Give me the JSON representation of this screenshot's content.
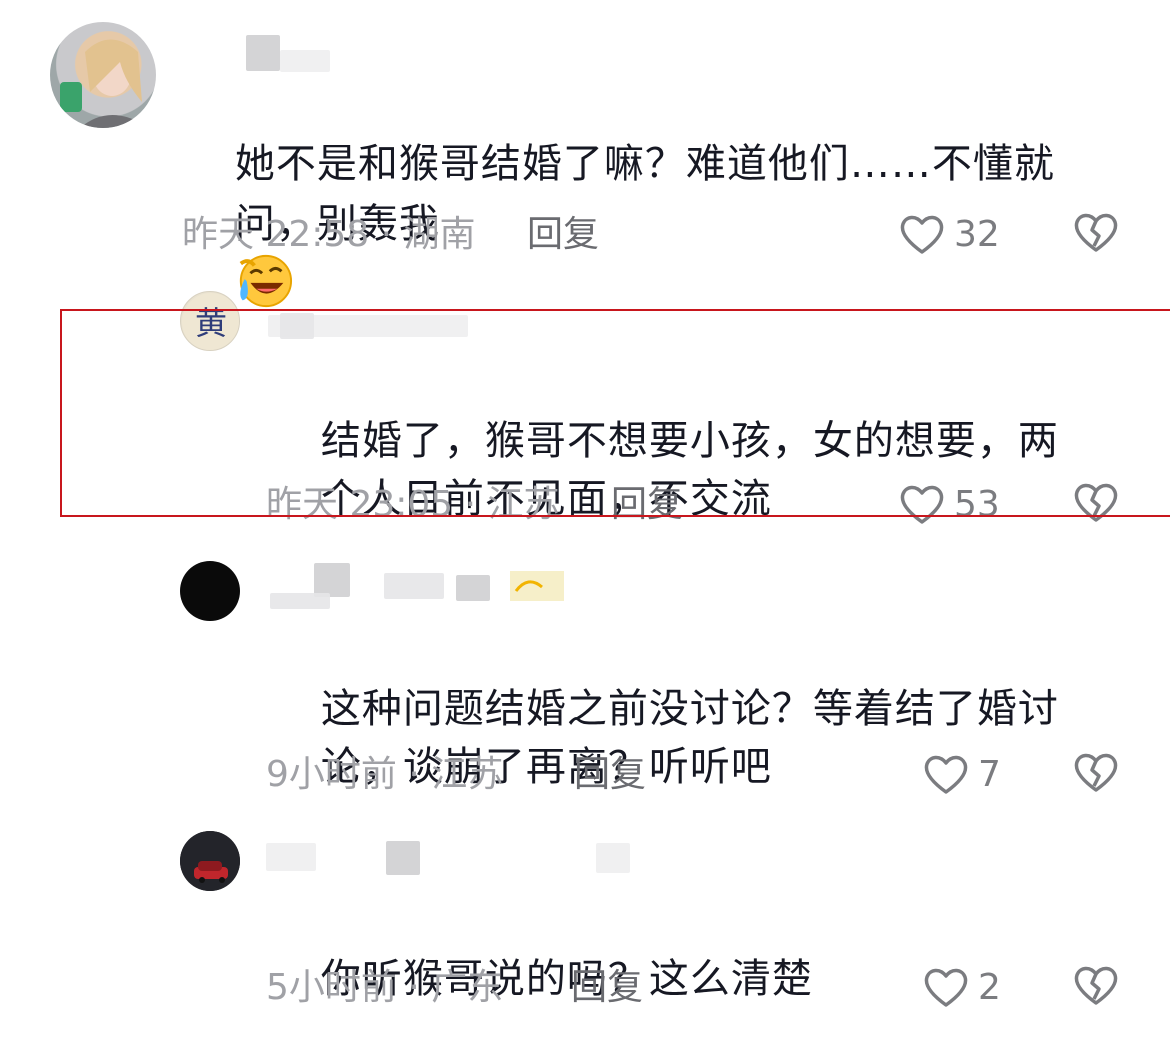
{
  "comments": [
    {
      "text_line1": "她不是和猴哥结婚了嘛？难道他们……不懂就",
      "text_line2": "问，别轰我",
      "emoji": "laughing-tears-emoji",
      "time": "昨天 22:58",
      "location": "· 湖南",
      "reply": "回复",
      "likes": "32"
    },
    {
      "text_line1": "结婚了，猴哥不想要小孩，女的想要，两",
      "text_line2": "个人目前不见面，不交流",
      "avatar_char": "黄",
      "time": "昨天 23:05",
      "location": "· 江苏",
      "reply": "回复",
      "likes": "53"
    },
    {
      "text_line1": "这种问题结婚之前没讨论？等着结了婚讨",
      "text_line2": "论，谈崩了再离？听听吧",
      "time": "9小时前",
      "location": "· 江苏",
      "reply": "回复",
      "likes": "7"
    },
    {
      "text_line1": "你听猴哥说的吗？这么清楚",
      "time": "5小时前",
      "location": "· 广东",
      "reply": "回复",
      "likes": "2"
    }
  ],
  "icons": {
    "like": "heart-outline-icon",
    "dislike": "broken-heart-icon"
  },
  "colors": {
    "highlight": "#c8161d",
    "meta": "#a0a1a6",
    "text": "#161823"
  }
}
